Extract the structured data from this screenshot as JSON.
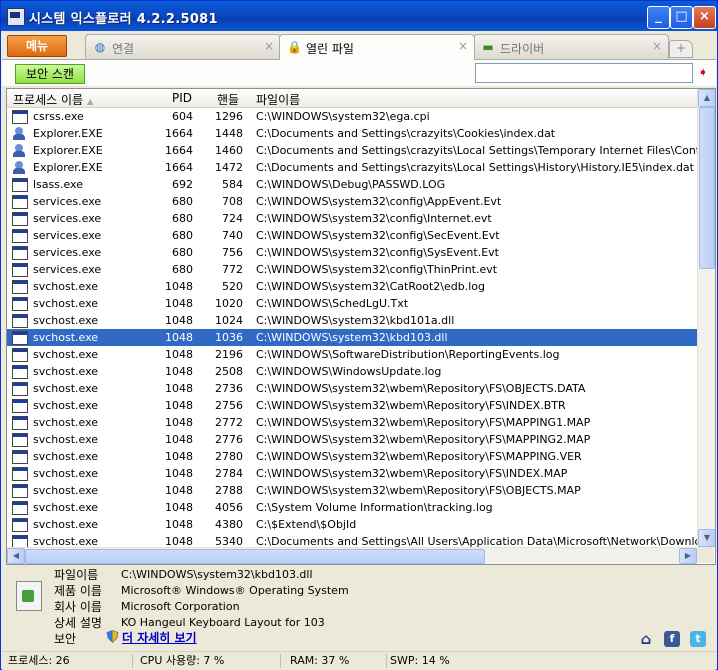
{
  "window": {
    "title": "시스템 익스플로러 4.2.2.5081",
    "minimize": "_",
    "maximize": "□",
    "close": "×"
  },
  "menu_label": "메뉴",
  "tabs": [
    {
      "label": "연결",
      "icon": "globe-icon",
      "glyph": "◍",
      "close": "×"
    },
    {
      "label": "열린 파일",
      "icon": "lock-icon",
      "glyph": "🔒",
      "close": "×"
    },
    {
      "label": "드라이버",
      "icon": "chip-icon",
      "glyph": "▬",
      "close": "×"
    }
  ],
  "new_tab_glyph": "+",
  "toolbar": {
    "scan_label": "보안 스캔",
    "search_placeholder": "",
    "search_value": ""
  },
  "columns": {
    "name": "프로세스 이름",
    "pid": "PID",
    "handle": "핸들",
    "path": "파일이름",
    "sort_glyph": "▲"
  },
  "rows": [
    {
      "name": "csrss.exe",
      "pid": "604",
      "handle": "1296",
      "path": "C:\\WINDOWS\\system32\\ega.cpi",
      "icon": "window"
    },
    {
      "name": "Explorer.EXE",
      "pid": "1664",
      "handle": "1448",
      "path": "C:\\Documents and Settings\\crazyits\\Cookies\\index.dat",
      "icon": "person"
    },
    {
      "name": "Explorer.EXE",
      "pid": "1664",
      "handle": "1460",
      "path": "C:\\Documents and Settings\\crazyits\\Local Settings\\Temporary Internet Files\\Content.IE5\\ind",
      "icon": "person"
    },
    {
      "name": "Explorer.EXE",
      "pid": "1664",
      "handle": "1472",
      "path": "C:\\Documents and Settings\\crazyits\\Local Settings\\History\\History.IE5\\index.dat",
      "icon": "person"
    },
    {
      "name": "lsass.exe",
      "pid": "692",
      "handle": "584",
      "path": "C:\\WINDOWS\\Debug\\PASSWD.LOG",
      "icon": "window"
    },
    {
      "name": "services.exe",
      "pid": "680",
      "handle": "708",
      "path": "C:\\WINDOWS\\system32\\config\\AppEvent.Evt",
      "icon": "window"
    },
    {
      "name": "services.exe",
      "pid": "680",
      "handle": "724",
      "path": "C:\\WINDOWS\\system32\\config\\Internet.evt",
      "icon": "window"
    },
    {
      "name": "services.exe",
      "pid": "680",
      "handle": "740",
      "path": "C:\\WINDOWS\\system32\\config\\SecEvent.Evt",
      "icon": "window"
    },
    {
      "name": "services.exe",
      "pid": "680",
      "handle": "756",
      "path": "C:\\WINDOWS\\system32\\config\\SysEvent.Evt",
      "icon": "window"
    },
    {
      "name": "services.exe",
      "pid": "680",
      "handle": "772",
      "path": "C:\\WINDOWS\\system32\\config\\ThinPrint.evt",
      "icon": "window"
    },
    {
      "name": "svchost.exe",
      "pid": "1048",
      "handle": "520",
      "path": "C:\\WINDOWS\\system32\\CatRoot2\\edb.log",
      "icon": "window"
    },
    {
      "name": "svchost.exe",
      "pid": "1048",
      "handle": "1020",
      "path": "C:\\WINDOWS\\SchedLgU.Txt",
      "icon": "window"
    },
    {
      "name": "svchost.exe",
      "pid": "1048",
      "handle": "1024",
      "path": "C:\\WINDOWS\\system32\\kbd101a.dll",
      "icon": "window"
    },
    {
      "name": "svchost.exe",
      "pid": "1048",
      "handle": "1036",
      "path": "C:\\WINDOWS\\system32\\kbd103.dll",
      "icon": "window",
      "selected": true
    },
    {
      "name": "svchost.exe",
      "pid": "1048",
      "handle": "2196",
      "path": "C:\\WINDOWS\\SoftwareDistribution\\ReportingEvents.log",
      "icon": "window"
    },
    {
      "name": "svchost.exe",
      "pid": "1048",
      "handle": "2508",
      "path": "C:\\WINDOWS\\WindowsUpdate.log",
      "icon": "window"
    },
    {
      "name": "svchost.exe",
      "pid": "1048",
      "handle": "2736",
      "path": "C:\\WINDOWS\\system32\\wbem\\Repository\\FS\\OBJECTS.DATA",
      "icon": "window"
    },
    {
      "name": "svchost.exe",
      "pid": "1048",
      "handle": "2756",
      "path": "C:\\WINDOWS\\system32\\wbem\\Repository\\FS\\INDEX.BTR",
      "icon": "window"
    },
    {
      "name": "svchost.exe",
      "pid": "1048",
      "handle": "2772",
      "path": "C:\\WINDOWS\\system32\\wbem\\Repository\\FS\\MAPPING1.MAP",
      "icon": "window"
    },
    {
      "name": "svchost.exe",
      "pid": "1048",
      "handle": "2776",
      "path": "C:\\WINDOWS\\system32\\wbem\\Repository\\FS\\MAPPING2.MAP",
      "icon": "window"
    },
    {
      "name": "svchost.exe",
      "pid": "1048",
      "handle": "2780",
      "path": "C:\\WINDOWS\\system32\\wbem\\Repository\\FS\\MAPPING.VER",
      "icon": "window"
    },
    {
      "name": "svchost.exe",
      "pid": "1048",
      "handle": "2784",
      "path": "C:\\WINDOWS\\system32\\wbem\\Repository\\FS\\INDEX.MAP",
      "icon": "window"
    },
    {
      "name": "svchost.exe",
      "pid": "1048",
      "handle": "2788",
      "path": "C:\\WINDOWS\\system32\\wbem\\Repository\\FS\\OBJECTS.MAP",
      "icon": "window"
    },
    {
      "name": "svchost.exe",
      "pid": "1048",
      "handle": "4056",
      "path": "C:\\System Volume Information\\tracking.log",
      "icon": "window"
    },
    {
      "name": "svchost.exe",
      "pid": "1048",
      "handle": "4380",
      "path": "C:\\$Extend\\$ObjId",
      "icon": "window"
    },
    {
      "name": "svchost.exe",
      "pid": "1048",
      "handle": "5340",
      "path": "C:\\Documents and Settings\\All Users\\Application Data\\Microsoft\\Network\\Downloader\\qmgr",
      "icon": "window"
    }
  ],
  "details": {
    "file_label": "파일이름",
    "file_value": "C:\\WINDOWS\\system32\\kbd103.dll",
    "product_label": "제품 이름",
    "product_value": "Microsoft® Windows® Operating System",
    "company_label": "회사 이름",
    "company_value": "Microsoft Corporation",
    "desc_label": "상세 설명",
    "desc_value": "KO Hangeul Keyboard Layout for 103",
    "security_label": "보안",
    "more_link": "더 자세히 보기"
  },
  "social": {
    "home": "⌂",
    "facebook": "f",
    "twitter": "t"
  },
  "colors": {
    "selection": "#316ac5",
    "title_bar": "#0a5bd7",
    "menu_button": "#de6a0d",
    "scan_button": "#8fe045"
  },
  "status": {
    "processes": "프로세스: 26",
    "cpu": "CPU 사용량: 7 %",
    "ram": "RAM: 37 %",
    "swap": "SWP: 14 %"
  }
}
